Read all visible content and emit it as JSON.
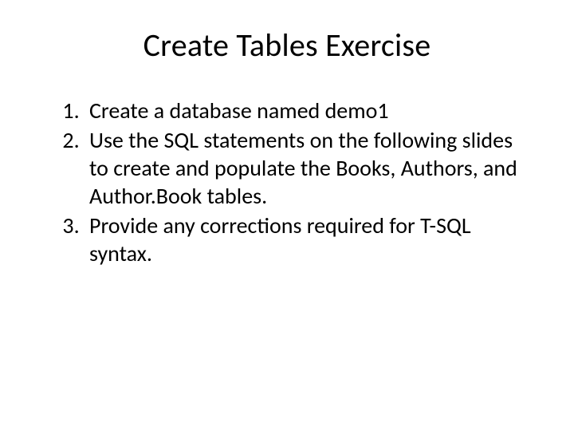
{
  "slide": {
    "title": "Create Tables Exercise",
    "items": [
      "Create a database named demo1",
      "Use the SQL statements on the following slides to create and populate the Books, Authors, and Author.Book tables.",
      "Provide any corrections required for T-SQL syntax."
    ]
  }
}
